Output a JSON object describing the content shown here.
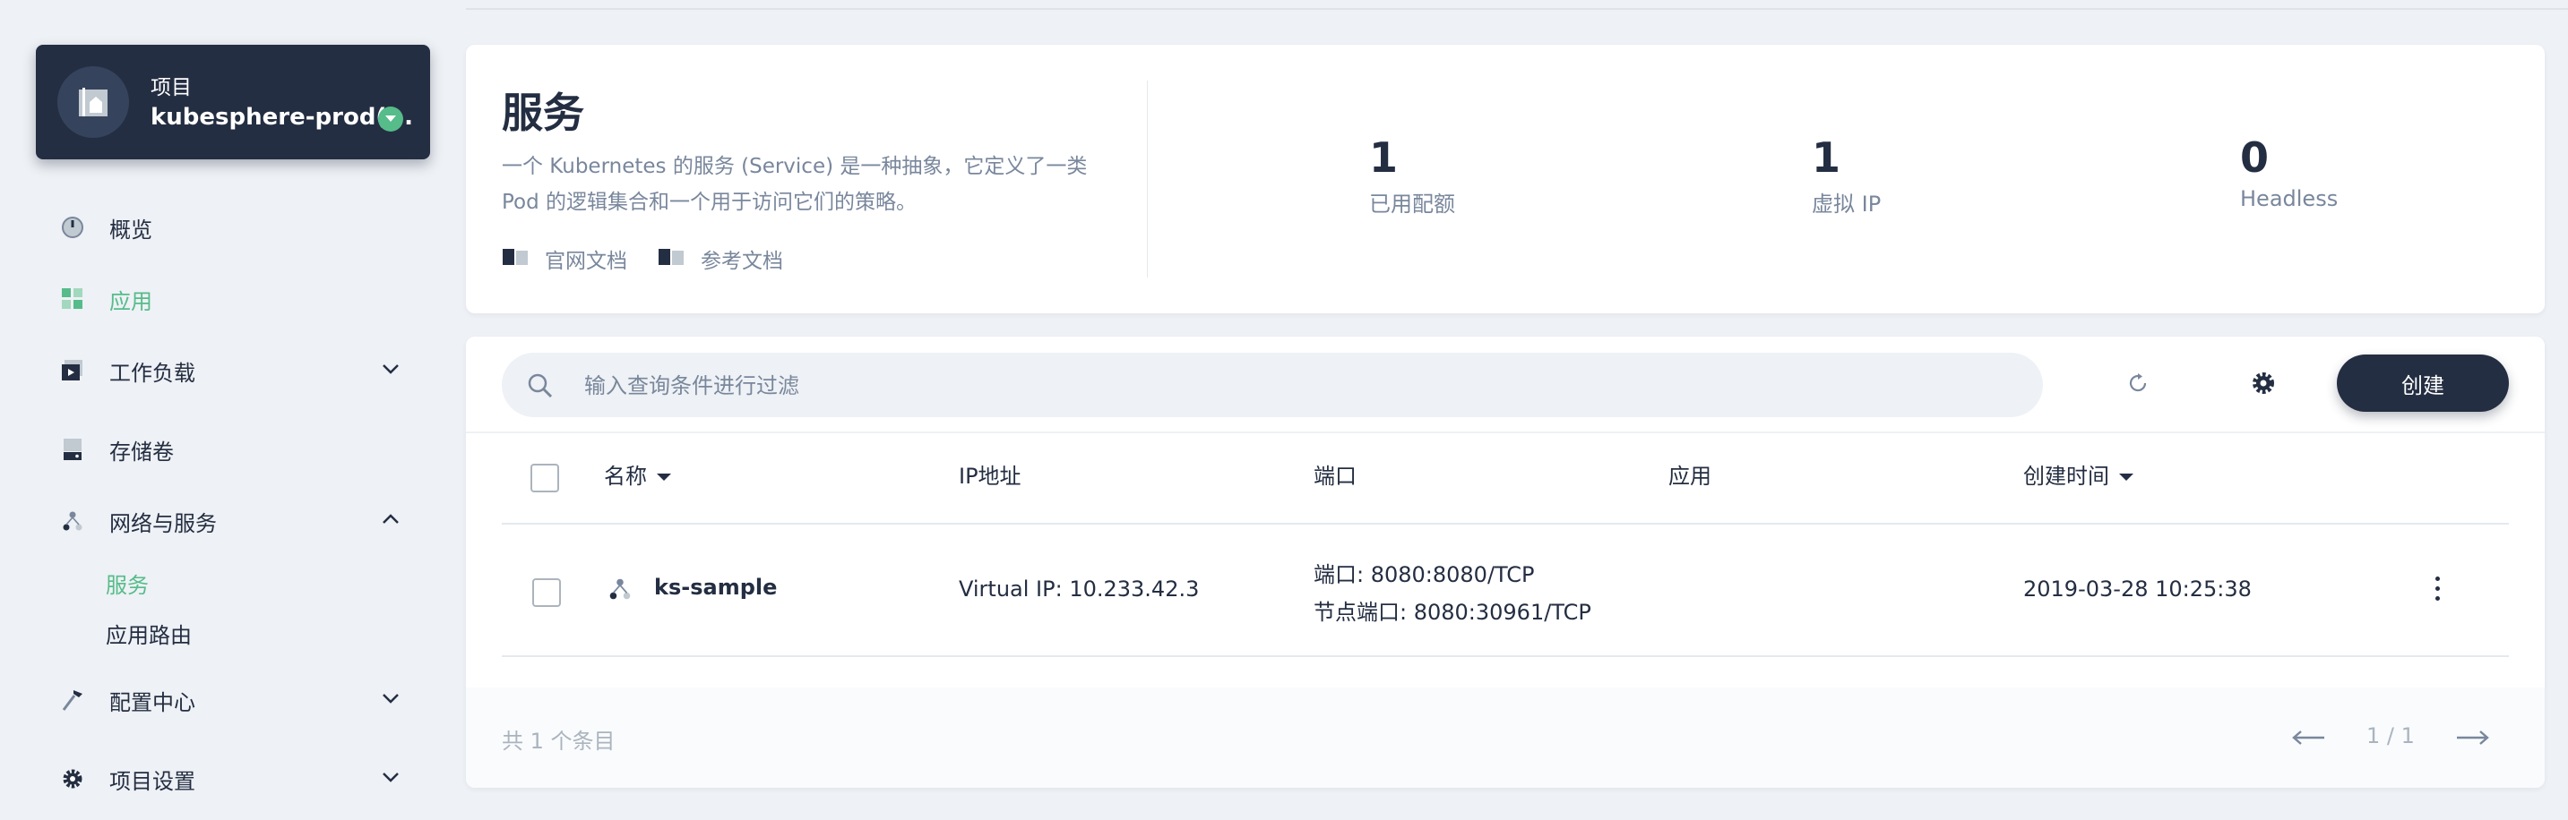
{
  "project": {
    "label": "项目",
    "name": "kubesphere-prod(..."
  },
  "sidebar": {
    "items": [
      {
        "label": "概览",
        "icon": "dashboard-icon"
      },
      {
        "label": "应用",
        "icon": "apps-icon",
        "active": true
      },
      {
        "label": "工作负载",
        "icon": "workload-icon",
        "expandable": true
      },
      {
        "label": "存储卷",
        "icon": "storage-icon"
      },
      {
        "label": "网络与服务",
        "icon": "network-icon",
        "expanded": true
      },
      {
        "label": "配置中心",
        "icon": "config-icon",
        "expandable": true
      },
      {
        "label": "项目设置",
        "icon": "gear-icon",
        "expandable": true
      }
    ],
    "network_sub": [
      {
        "label": "服务",
        "active": true
      },
      {
        "label": "应用路由"
      }
    ]
  },
  "header": {
    "title": "服务",
    "desc_line1": "一个 Kubernetes 的服务 (Service) 是一种抽象，它定义了一类",
    "desc_line2": "Pod 的逻辑集合和一个用于访问它们的策略。",
    "link_official": "官网文档",
    "link_reference": "参考文档",
    "stats": [
      {
        "value": "1",
        "label": "已用配额"
      },
      {
        "value": "1",
        "label": "虚拟 IP"
      },
      {
        "value": "0",
        "label": "Headless"
      }
    ]
  },
  "toolbar": {
    "search_placeholder": "输入查询条件进行过滤",
    "create_label": "创建"
  },
  "table": {
    "columns": [
      "名称",
      "IP地址",
      "端口",
      "应用",
      "创建时间"
    ],
    "rows": [
      {
        "name": "ks-sample",
        "ip": "Virtual IP: 10.233.42.3",
        "port": "端口: 8080:8080/TCP",
        "node_port": "节点端口: 8080:30961/TCP",
        "app": "",
        "created": "2019-03-28 10:25:38"
      }
    ]
  },
  "footer": {
    "count": "共 1 个条目",
    "page": "1 / 1"
  },
  "colors": {
    "accent": "#55bc8a",
    "dark": "#242e42",
    "muted": "#79879c"
  }
}
